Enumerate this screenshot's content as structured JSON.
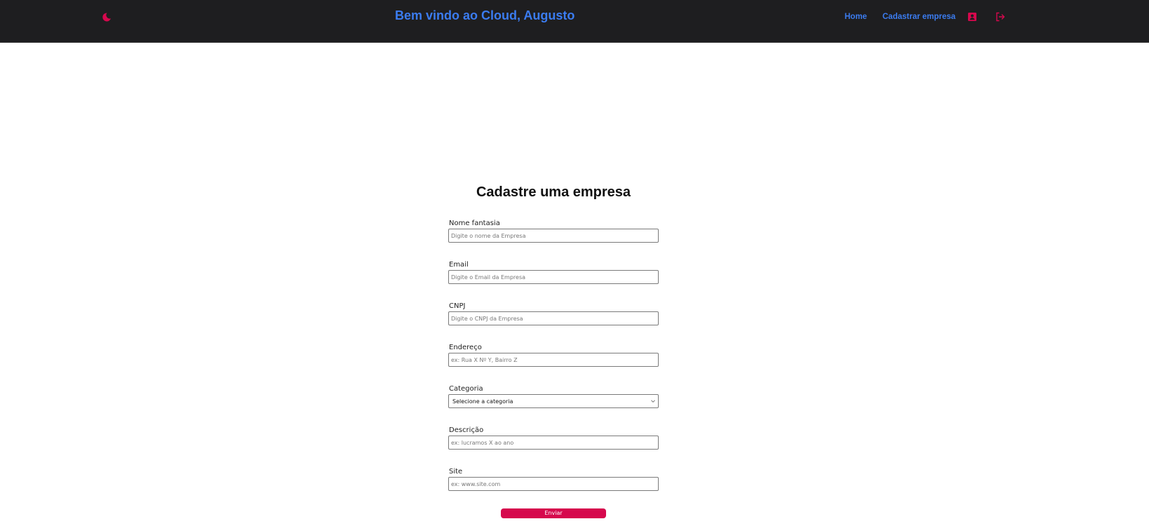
{
  "colors": {
    "header_bg": "#1e1e20",
    "accent_blue": "#3b7cf0",
    "accent_pink": "#d6084d"
  },
  "header": {
    "theme_icon": "moon-icon",
    "welcome_text": "Bem vindo ao Cloud, Augusto",
    "nav": {
      "home": "Home",
      "cadastrar": "Cadastrar empresa"
    },
    "profile_icon": "user-card-icon",
    "logout_icon": "logout-icon"
  },
  "form": {
    "title": "Cadastre uma empresa",
    "fields": {
      "nome": {
        "label": "Nome fantasia",
        "placeholder": "Digite o nome da Empresa"
      },
      "email": {
        "label": "Email",
        "placeholder": "Digite o Email da Empresa"
      },
      "cnpj": {
        "label": "CNPJ",
        "placeholder": "Digite o CNPJ da Empresa"
      },
      "endereco": {
        "label": "Endereço",
        "placeholder": "ex: Rua X Nº Y, Bairro Z"
      },
      "categoria": {
        "label": "Categoria",
        "selected": "Selecione a categoria"
      },
      "descricao": {
        "label": "Descrição",
        "placeholder": "ex: lucramos X ao ano"
      },
      "site": {
        "label": "Site",
        "placeholder": "ex: www.site.com"
      }
    },
    "submit_label": "Enviar"
  }
}
